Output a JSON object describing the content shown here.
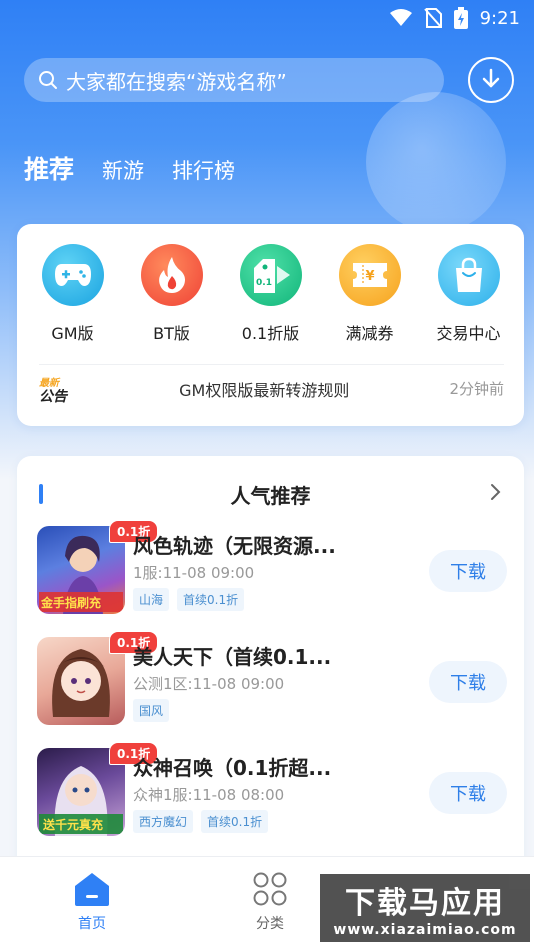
{
  "status_bar": {
    "time": "9:21"
  },
  "search": {
    "placeholder": "大家都在搜索“游戏名称”"
  },
  "tabs": [
    {
      "label": "推荐",
      "active": true
    },
    {
      "label": "新游",
      "active": false
    },
    {
      "label": "排行榜",
      "active": false
    }
  ],
  "features": [
    {
      "label": "GM版",
      "icon": "gamepad-icon",
      "color": "#2fb4e6"
    },
    {
      "label": "BT版",
      "icon": "flame-icon",
      "color": "#f2533a"
    },
    {
      "label": "0.1折版",
      "icon": "discount-tag-icon",
      "color": "#1ec48a"
    },
    {
      "label": "满减券",
      "icon": "coupon-icon",
      "color": "#f7a623"
    },
    {
      "label": "交易中心",
      "icon": "shopping-bag-icon",
      "color": "#3fb8ee"
    }
  ],
  "notice": {
    "badge_top": "最新",
    "badge_bottom": "公告",
    "text": "GM权限版最新转游规则",
    "time": "2分钟前"
  },
  "popular": {
    "title": "人气推荐",
    "download_label": "下载",
    "games": [
      {
        "badge": "0.1折",
        "title": "风色轨迹（无限资源...",
        "subtitle": "1服:11-08 09:00",
        "tags": [
          "山海",
          "首续0.1折"
        ],
        "thumb_overlay": "金手指刷充"
      },
      {
        "badge": "0.1折",
        "title": "美人天下（首续0.1...",
        "subtitle": "公测1区:11-08 09:00",
        "tags": [
          "国风"
        ],
        "thumb_overlay": ""
      },
      {
        "badge": "0.1折",
        "title": "众神召唤（0.1折超...",
        "subtitle": "众神1服:11-08 08:00",
        "tags": [
          "西方魔幻",
          "首续0.1折"
        ],
        "thumb_overlay": "送千元真充"
      }
    ]
  },
  "bottom_nav": [
    {
      "label": "首页",
      "icon": "home-icon",
      "active": true
    },
    {
      "label": "分类",
      "icon": "grid-icon",
      "active": false
    }
  ],
  "watermark": {
    "big": "下载马应用",
    "small": "www.xiazaimiao.com"
  },
  "colors": {
    "primary": "#2f80f5",
    "badge_red": "#f0403c"
  }
}
